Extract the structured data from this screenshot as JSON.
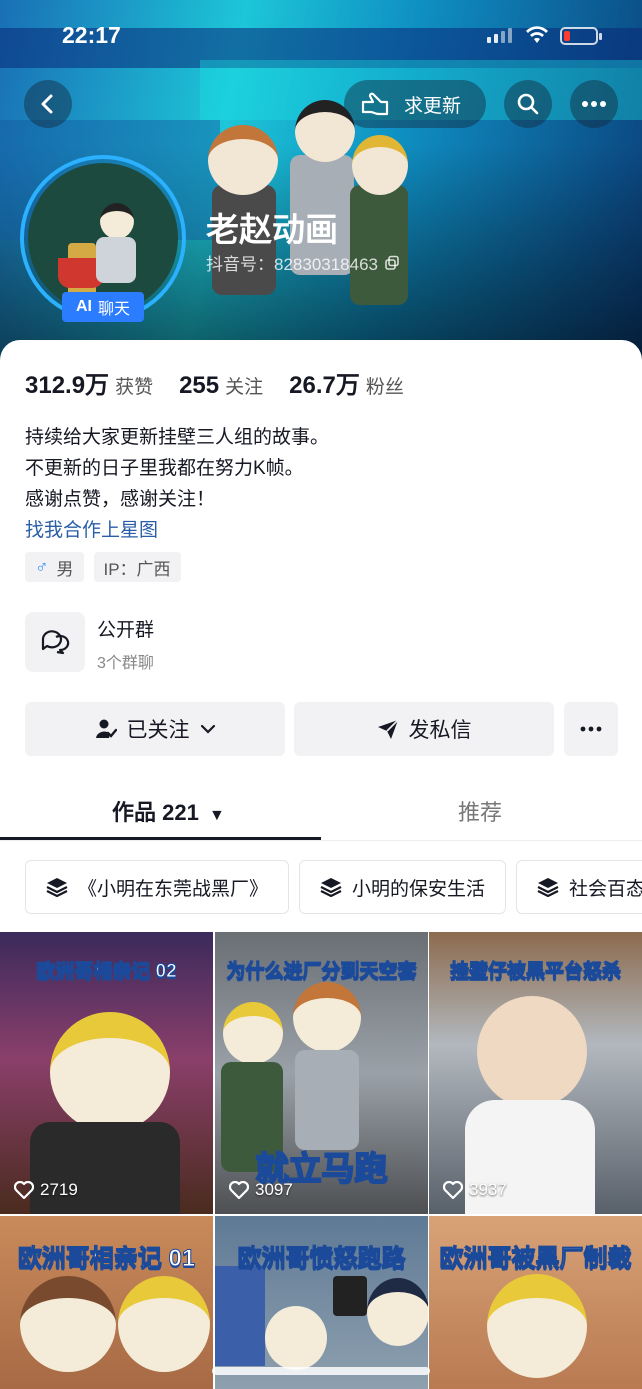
{
  "status_bar": {
    "time": "22:17"
  },
  "header": {
    "back_icon": "chevron-left-icon",
    "request_update_label": "求更新",
    "search_icon": "search-icon",
    "more_icon": "more-icon"
  },
  "profile": {
    "name": "老赵动画",
    "douyin_id": "抖音号：82830318463",
    "ai_badge_ai": "AI",
    "ai_badge_label": "聊天"
  },
  "stats": [
    {
      "value": "312.9万",
      "label": "获赞"
    },
    {
      "value": "255",
      "label": "关注"
    },
    {
      "value": "26.7万",
      "label": "粉丝"
    }
  ],
  "bio": {
    "lines": [
      "持续给大家更新挂壁三人组的故事。",
      "不更新的日子里我都在努力K帧。",
      "感谢点赞，感谢关注！"
    ],
    "link": "找我合作上星图"
  },
  "tags": {
    "gender": "男",
    "ip": "IP：广西"
  },
  "group": {
    "title": "公开群",
    "subtitle": "3个群聊"
  },
  "actions": {
    "followed": "已关注",
    "message": "发私信"
  },
  "tabs": {
    "works": "作品 221",
    "recommend": "推荐"
  },
  "collections": [
    "《小明在东莞战黑厂》",
    "小明的保安生活",
    "社会百态"
  ],
  "videos": [
    {
      "title": "欧洲哥相亲记 02",
      "likes": "2719"
    },
    {
      "title": "为什么进厂分到天空套",
      "subtitle": "就立马跑",
      "likes": "3097"
    },
    {
      "title": "挂壁仔被黑平台怒杀",
      "likes": "3937"
    },
    {
      "title": "欧洲哥相亲记 01",
      "likes": ""
    },
    {
      "title": "欧洲哥愤怒跑路",
      "likes": ""
    },
    {
      "title": "欧洲哥被黑厂制裁",
      "likes": ""
    }
  ]
}
